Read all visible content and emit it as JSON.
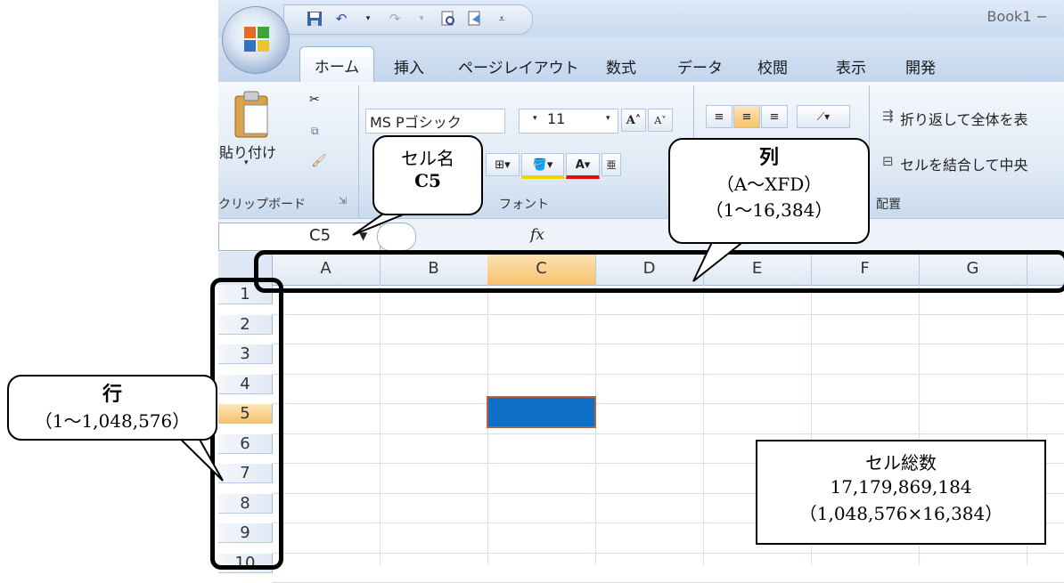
{
  "window": {
    "title": "Book1 −",
    "tabs": [
      "ホーム",
      "挿入",
      "ページレイアウト",
      "数式",
      "データ",
      "校閲",
      "表示",
      "開発"
    ]
  },
  "ribbon": {
    "paste_label": "貼り付け",
    "clipboard_group": "クリップボード",
    "font_name": "MS Pゴシック",
    "font_size": "11",
    "font_group": "フォント",
    "wrap_text": "折り返して全体を表",
    "merge_center": "セルを結合して中央",
    "alignment_group": "配置"
  },
  "formula_bar": {
    "name_box": "C5",
    "fx": "fx"
  },
  "grid": {
    "columns": [
      "A",
      "B",
      "C",
      "D",
      "E",
      "F",
      "G"
    ],
    "rows": [
      "1",
      "2",
      "3",
      "4",
      "5",
      "6",
      "7",
      "8",
      "9",
      "10"
    ],
    "active_column": "C",
    "active_row": "5"
  },
  "annotations": {
    "cell_name": {
      "line1": "セル名",
      "line2": "C5"
    },
    "column": {
      "line1": "列",
      "line2": "（A〜XFD）",
      "line3": "（1〜16,384）"
    },
    "row": {
      "line1": "行",
      "line2": "（1〜1,048,576）"
    },
    "total_cells": {
      "line1": "セル総数",
      "line2": "17,179,869,184",
      "line3": "（1,048,576×16,384）"
    }
  }
}
